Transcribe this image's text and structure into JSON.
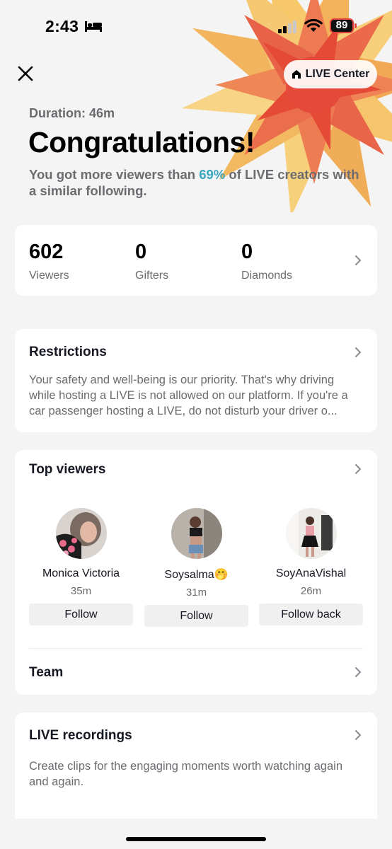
{
  "status_bar": {
    "time": "2:43",
    "battery": "89"
  },
  "header": {
    "live_center_label": "LIVE Center"
  },
  "summary": {
    "duration": "Duration: 46m",
    "title": "Congratulations!",
    "subtitle_prefix": "You got more viewers than ",
    "subtitle_percent": "69%",
    "subtitle_suffix": " of LIVE creators with a similar following."
  },
  "stats": [
    {
      "value": "602",
      "label": "Viewers"
    },
    {
      "value": "0",
      "label": "Gifters"
    },
    {
      "value": "0",
      "label": "Diamonds"
    }
  ],
  "restrictions": {
    "title": "Restrictions",
    "body": "Your safety and well-being is our priority. That's why driving while hosting a LIVE is not allowed on our platform. If you're a car passenger hosting a LIVE, do not disturb your driver o..."
  },
  "top_viewers": {
    "title": "Top viewers",
    "viewers": [
      {
        "name": "Monica Victoria",
        "time": "35m",
        "button": "Follow"
      },
      {
        "name": "Soysalma🤭",
        "time": "31m",
        "button": "Follow"
      },
      {
        "name": "SoyAnaVishal",
        "time": "26m",
        "button": "Follow back"
      }
    ],
    "team_label": "Team"
  },
  "recordings": {
    "title": "LIVE recordings",
    "body": "Create clips for the engaging moments worth watching again and again."
  },
  "colors": {
    "accent": "#3aa7c2",
    "background": "#f4f4f4"
  }
}
